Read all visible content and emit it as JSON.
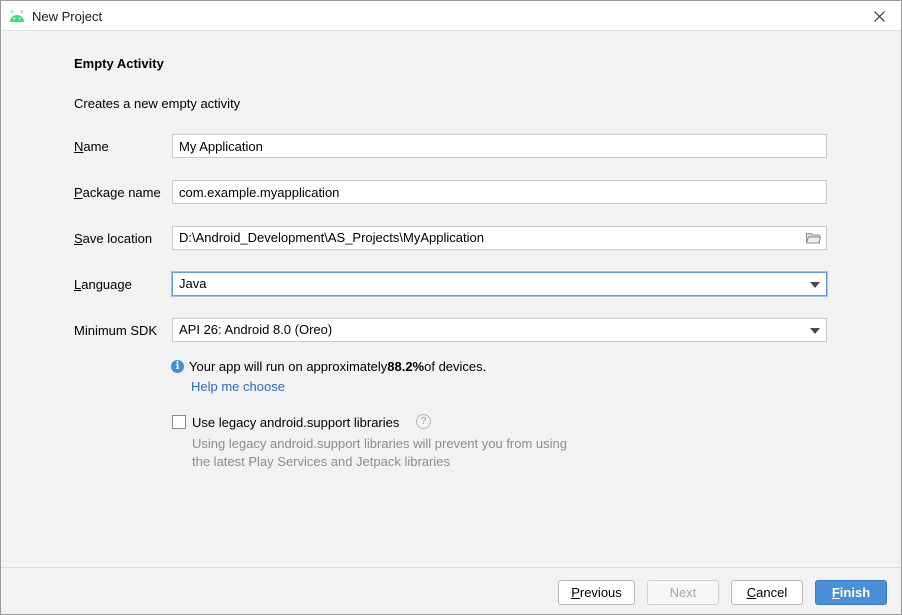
{
  "window": {
    "title": "New Project",
    "app_icon": "android-icon",
    "accent": "#4b8fd8",
    "android_green": "#3ddc84"
  },
  "page": {
    "heading": "Empty Activity",
    "subheading": "Creates a new empty activity"
  },
  "form": {
    "name": {
      "label_mnemonic": "N",
      "label_rest": "ame",
      "value": "My Application"
    },
    "package": {
      "label_mnemonic": "P",
      "label_rest": "ackage name",
      "value": "com.example.myapplication"
    },
    "save_location": {
      "label_mnemonic": "S",
      "label_rest": "ave location",
      "value": "D:\\Android_Development\\AS_Projects\\MyApplication"
    },
    "language": {
      "label_mnemonic": "L",
      "label_rest": "anguage",
      "value": "Java"
    },
    "min_sdk": {
      "label": "Minimum SDK",
      "value": "API 26: Android 8.0 (Oreo)"
    }
  },
  "info": {
    "prefix": "Your app will run on approximately ",
    "percent": "88.2%",
    "suffix": " of devices.",
    "link": "Help me choose"
  },
  "legacy": {
    "checked": false,
    "label": "Use legacy android.support libraries",
    "hint_line1": "Using legacy android.support libraries will prevent you from using",
    "hint_line2": "the latest Play Services and Jetpack libraries"
  },
  "buttons": {
    "previous_mnemonic": "P",
    "previous_rest": "revious",
    "next": "Next",
    "cancel_mnemonic": "C",
    "cancel_rest": "ancel",
    "finish_mnemonic": "F",
    "finish_rest": "inish"
  }
}
